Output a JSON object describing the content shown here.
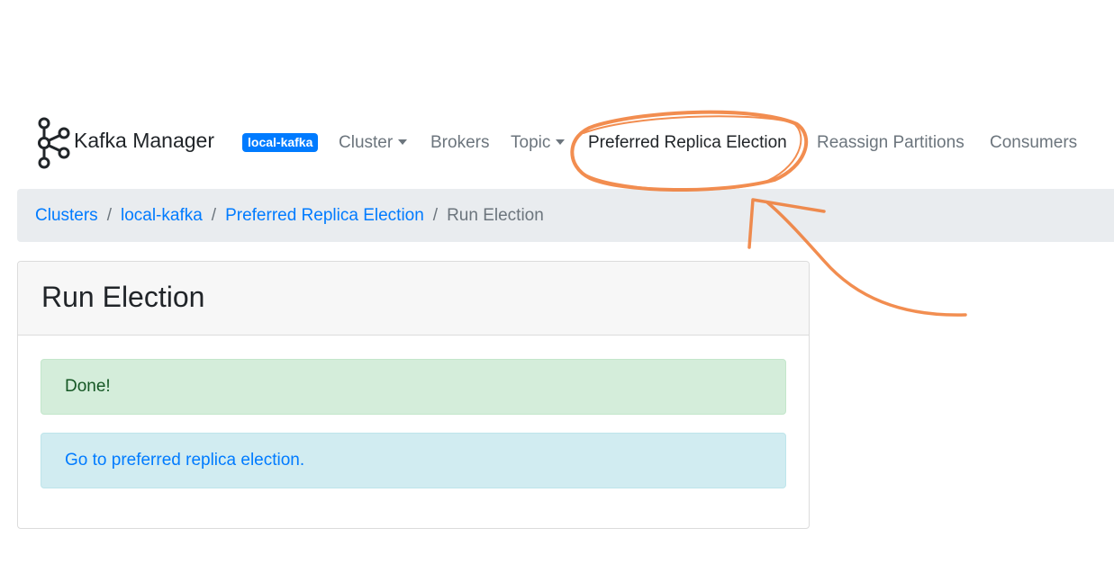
{
  "navbar": {
    "brand": "Kafka Manager",
    "cluster_badge": "local-kafka",
    "items": [
      {
        "label": "Cluster"
      },
      {
        "label": "Brokers"
      },
      {
        "label": "Topic"
      },
      {
        "label": "Preferred Replica Election"
      },
      {
        "label": "Reassign Partitions"
      },
      {
        "label": "Consumers"
      }
    ]
  },
  "breadcrumb": {
    "items": [
      "Clusters",
      "local-kafka",
      "Preferred Replica Election"
    ],
    "current": "Run Election",
    "separator": "/"
  },
  "card": {
    "title": "Run Election",
    "success_message": "Done!",
    "info_link": "Go to preferred replica election."
  },
  "colors": {
    "primary": "#007bff",
    "annotation": "#f07a32",
    "success_bg": "#d4edda",
    "info_bg": "#d1ecf1"
  },
  "icons": {
    "brand_logo": "kafka-logo-icon",
    "dropdown": "caret-down-icon"
  }
}
